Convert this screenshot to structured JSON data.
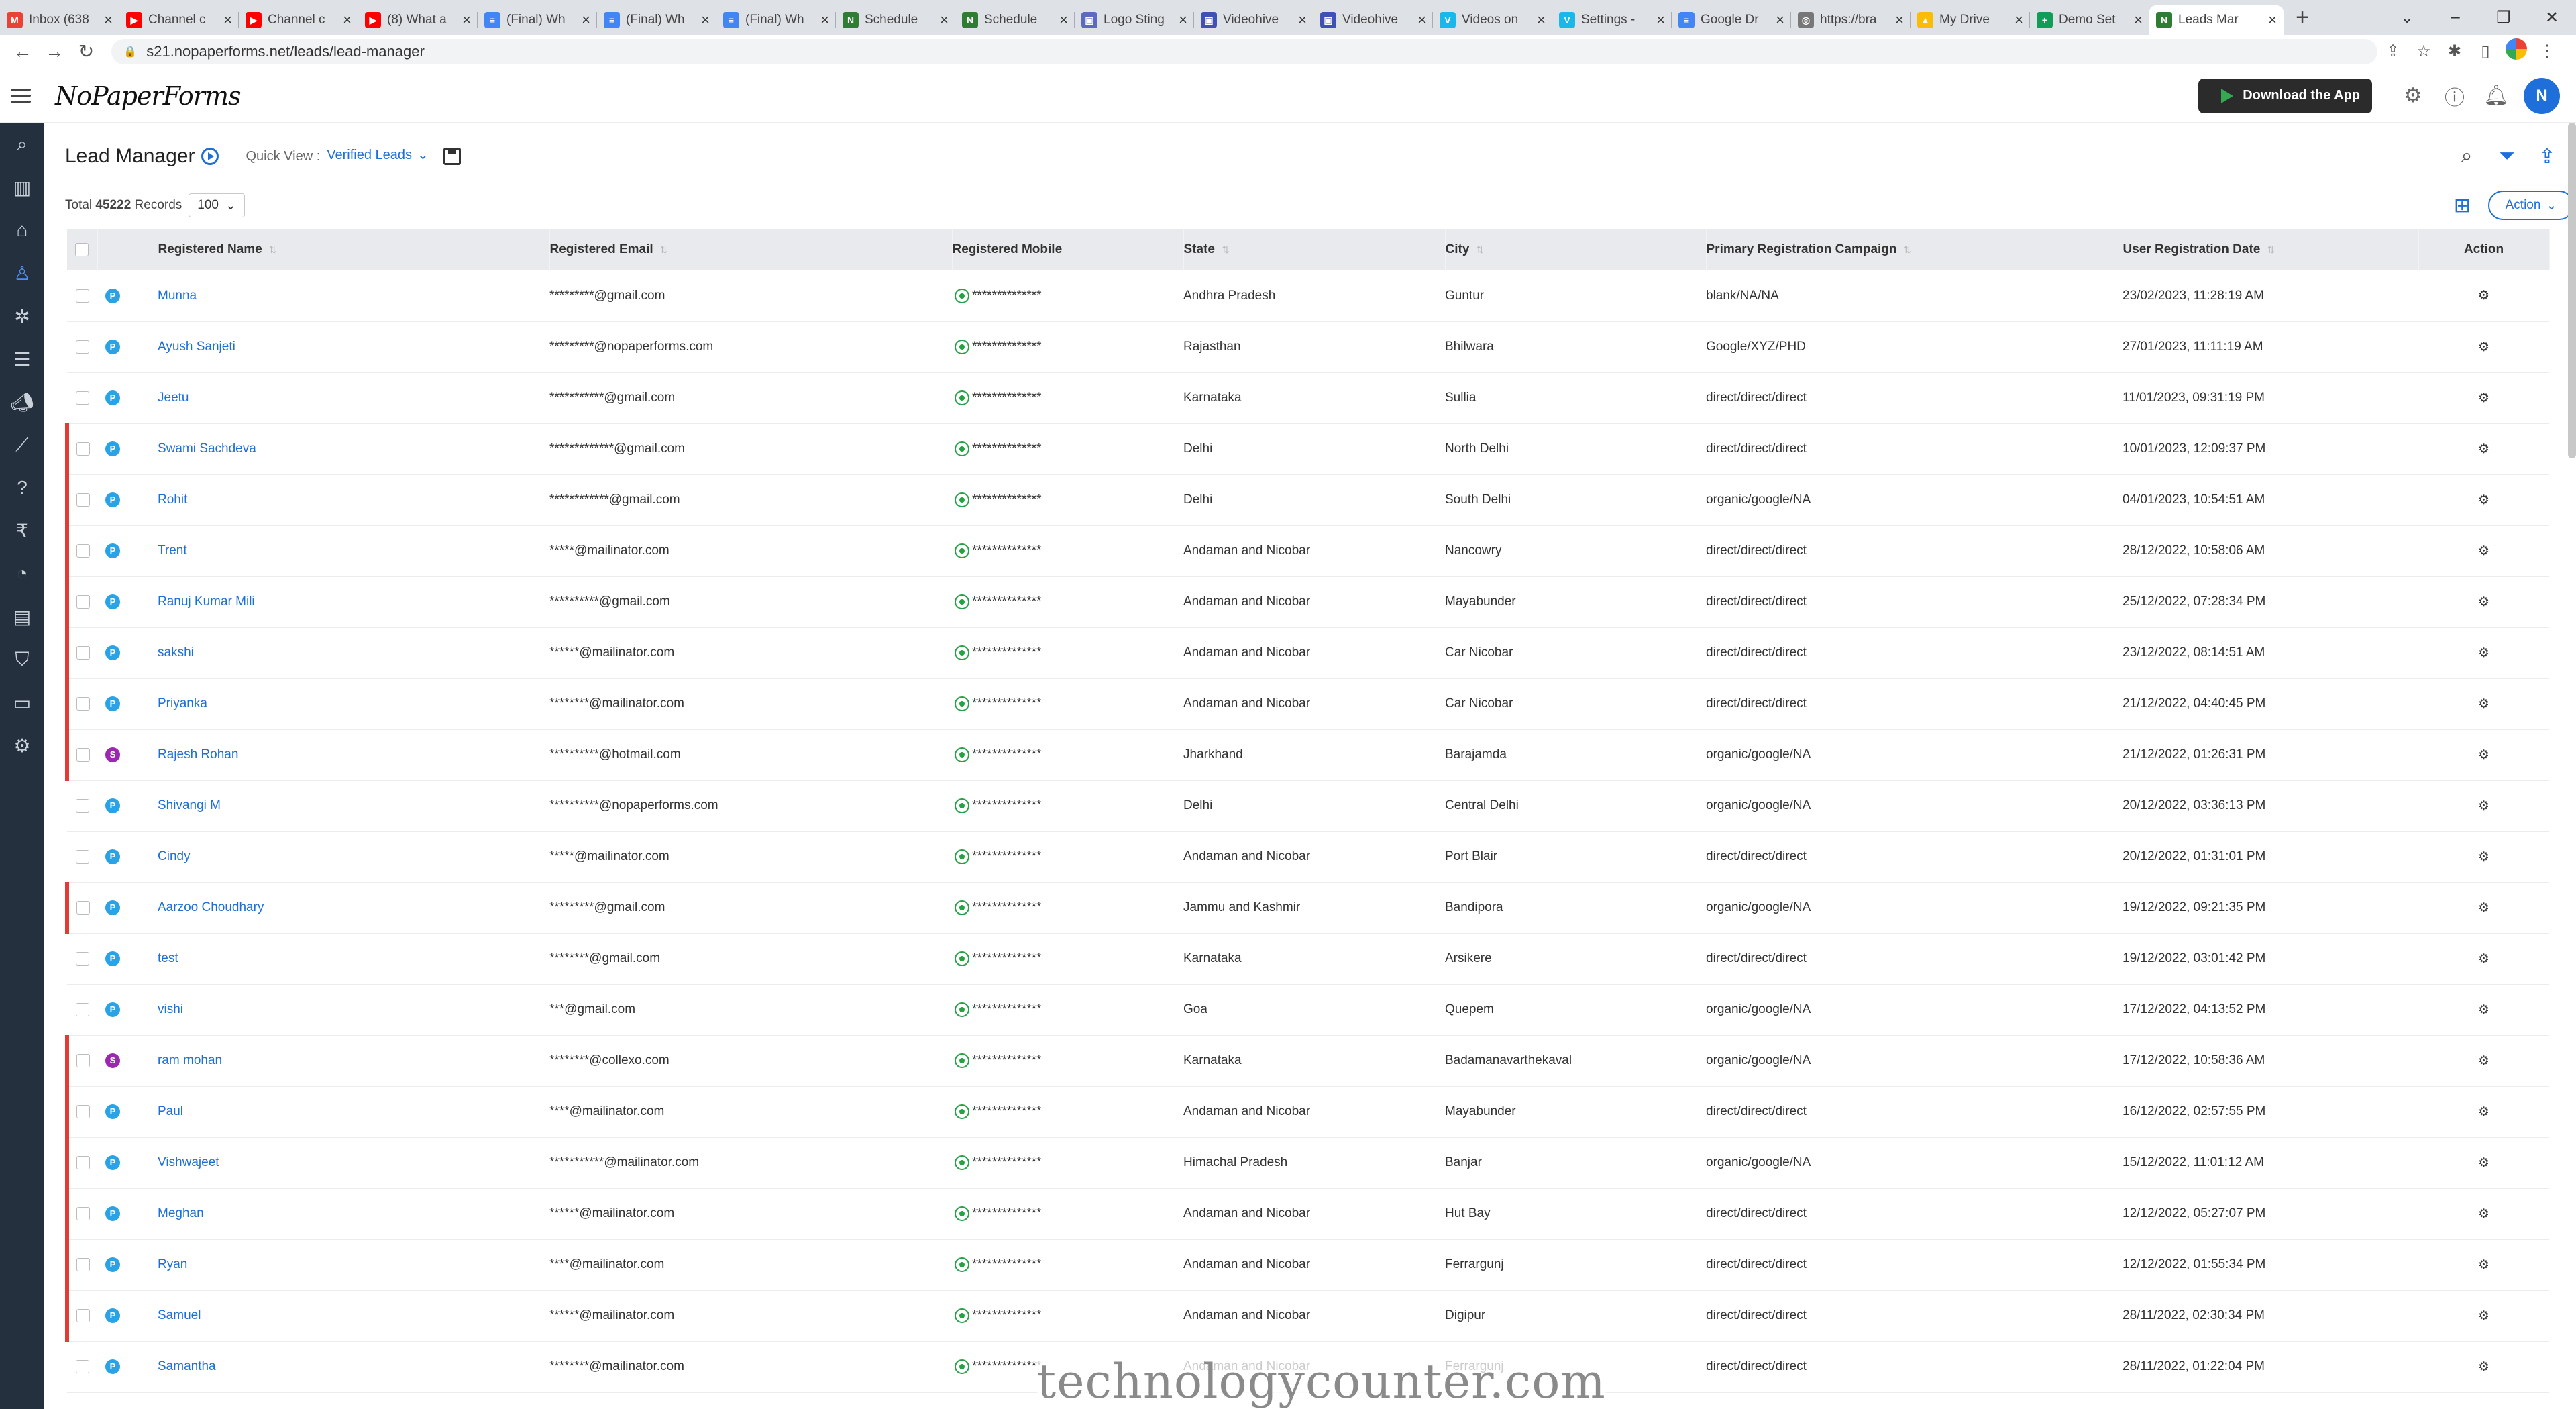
{
  "browser": {
    "tabs": [
      {
        "title": "Inbox (638",
        "icon": "M",
        "color": "#ea4335"
      },
      {
        "title": "Channel c",
        "icon": "▶",
        "color": "#ff0000"
      },
      {
        "title": "Channel c",
        "icon": "▶",
        "color": "#ff0000"
      },
      {
        "title": "(8) What a",
        "icon": "▶",
        "color": "#ff0000"
      },
      {
        "title": "(Final) Wh",
        "icon": "≡",
        "color": "#4285f4"
      },
      {
        "title": "(Final) Wh",
        "icon": "≡",
        "color": "#4285f4"
      },
      {
        "title": "(Final) Wh",
        "icon": "≡",
        "color": "#4285f4"
      },
      {
        "title": "Schedule",
        "icon": "N",
        "color": "#2e7d32"
      },
      {
        "title": "Schedule",
        "icon": "N",
        "color": "#2e7d32"
      },
      {
        "title": "Logo Sting",
        "icon": "▣",
        "color": "#5c6bc0"
      },
      {
        "title": "Videohive",
        "icon": "▣",
        "color": "#3f51b5"
      },
      {
        "title": "Videohive",
        "icon": "▣",
        "color": "#3f51b5"
      },
      {
        "title": "Videos on",
        "icon": "V",
        "color": "#1ab7ea"
      },
      {
        "title": "Settings -",
        "icon": "V",
        "color": "#1ab7ea"
      },
      {
        "title": "Google Dr",
        "icon": "≡",
        "color": "#4285f4"
      },
      {
        "title": "https://bra",
        "icon": "◎",
        "color": "#777777"
      },
      {
        "title": "My Drive",
        "icon": "▲",
        "color": "#fbbc05"
      },
      {
        "title": "Demo Set",
        "icon": "+",
        "color": "#0f9d58"
      },
      {
        "title": "Leads Mar",
        "icon": "N",
        "color": "#2e7d32",
        "active": true
      }
    ],
    "url": "s21.nopaperforms.net/leads/lead-manager"
  },
  "header": {
    "logo": "NoPaperForms",
    "download_label": "Download the App",
    "avatar_initial": "N"
  },
  "page": {
    "title": "Lead Manager",
    "quick_view_label": "Quick View :",
    "quick_view_value": "Verified Leads",
    "total_label": "Total",
    "total_count": "45222",
    "records_label": "Records",
    "page_size": "100",
    "action_label": "Action"
  },
  "table": {
    "columns": [
      "Registered Name",
      "Registered Email",
      "Registered Mobile",
      "State",
      "City",
      "Primary Registration Campaign",
      "User Registration Date",
      "Action"
    ],
    "rows": [
      {
        "flag": false,
        "src": "P",
        "name": "Munna",
        "email": "*********@gmail.com",
        "mobile": "**************",
        "state": "Andhra Pradesh",
        "city": "Guntur",
        "campaign": "blank/NA/NA",
        "date": "23/02/2023, 11:28:19 AM"
      },
      {
        "flag": false,
        "src": "P",
        "name": "Ayush Sanjeti",
        "email": "*********@nopaperforms.com",
        "mobile": "**************",
        "state": "Rajasthan",
        "city": "Bhilwara",
        "campaign": "Google/XYZ/PHD",
        "date": "27/01/2023, 11:11:19 AM"
      },
      {
        "flag": false,
        "src": "P",
        "name": "Jeetu",
        "email": "***********@gmail.com",
        "mobile": "**************",
        "state": "Karnataka",
        "city": "Sullia",
        "campaign": "direct/direct/direct",
        "date": "11/01/2023, 09:31:19 PM"
      },
      {
        "flag": true,
        "src": "P",
        "name": "Swami Sachdeva",
        "email": "*************@gmail.com",
        "mobile": "**************",
        "state": "Delhi",
        "city": "North Delhi",
        "campaign": "direct/direct/direct",
        "date": "10/01/2023, 12:09:37 PM"
      },
      {
        "flag": true,
        "src": "P",
        "name": "Rohit",
        "email": "************@gmail.com",
        "mobile": "**************",
        "state": "Delhi",
        "city": "South Delhi",
        "campaign": "organic/google/NA",
        "date": "04/01/2023, 10:54:51 AM"
      },
      {
        "flag": true,
        "src": "P",
        "name": "Trent",
        "email": "*****@mailinator.com",
        "mobile": "**************",
        "state": "Andaman and Nicobar",
        "city": "Nancowry",
        "campaign": "direct/direct/direct",
        "date": "28/12/2022, 10:58:06 AM"
      },
      {
        "flag": true,
        "src": "P",
        "name": "Ranuj Kumar Mili",
        "email": "**********@gmail.com",
        "mobile": "**************",
        "state": "Andaman and Nicobar",
        "city": "Mayabunder",
        "campaign": "direct/direct/direct",
        "date": "25/12/2022, 07:28:34 PM"
      },
      {
        "flag": true,
        "src": "P",
        "name": "sakshi",
        "email": "******@mailinator.com",
        "mobile": "**************",
        "state": "Andaman and Nicobar",
        "city": "Car Nicobar",
        "campaign": "direct/direct/direct",
        "date": "23/12/2022, 08:14:51 AM"
      },
      {
        "flag": true,
        "src": "P",
        "name": "Priyanka",
        "email": "********@mailinator.com",
        "mobile": "**************",
        "state": "Andaman and Nicobar",
        "city": "Car Nicobar",
        "campaign": "direct/direct/direct",
        "date": "21/12/2022, 04:40:45 PM"
      },
      {
        "flag": true,
        "src": "S",
        "name": "Rajesh Rohan",
        "email": "**********@hotmail.com",
        "mobile": "**************",
        "state": "Jharkhand",
        "city": "Barajamda",
        "campaign": "organic/google/NA",
        "date": "21/12/2022, 01:26:31 PM"
      },
      {
        "flag": false,
        "src": "P",
        "name": "Shivangi M",
        "email": "**********@nopaperforms.com",
        "mobile": "**************",
        "state": "Delhi",
        "city": "Central Delhi",
        "campaign": "organic/google/NA",
        "date": "20/12/2022, 03:36:13 PM"
      },
      {
        "flag": false,
        "src": "P",
        "name": "Cindy",
        "email": "*****@mailinator.com",
        "mobile": "**************",
        "state": "Andaman and Nicobar",
        "city": "Port Blair",
        "campaign": "direct/direct/direct",
        "date": "20/12/2022, 01:31:01 PM"
      },
      {
        "flag": true,
        "src": "P",
        "name": "Aarzoo Choudhary",
        "email": "*********@gmail.com",
        "mobile": "**************",
        "state": "Jammu and Kashmir",
        "city": "Bandipora",
        "campaign": "organic/google/NA",
        "date": "19/12/2022, 09:21:35 PM"
      },
      {
        "flag": false,
        "src": "P",
        "name": "test",
        "email": "********@gmail.com",
        "mobile": "**************",
        "state": "Karnataka",
        "city": "Arsikere",
        "campaign": "direct/direct/direct",
        "date": "19/12/2022, 03:01:42 PM"
      },
      {
        "flag": false,
        "src": "P",
        "name": "vishi",
        "email": "***@gmail.com",
        "mobile": "**************",
        "state": "Goa",
        "city": "Quepem",
        "campaign": "organic/google/NA",
        "date": "17/12/2022, 04:13:52 PM"
      },
      {
        "flag": true,
        "src": "S",
        "name": "ram mohan",
        "email": "********@collexo.com",
        "mobile": "**************",
        "state": "Karnataka",
        "city": "Badamanavarthekaval",
        "campaign": "organic/google/NA",
        "date": "17/12/2022, 10:58:36 AM"
      },
      {
        "flag": true,
        "src": "P",
        "name": "Paul",
        "email": "****@mailinator.com",
        "mobile": "**************",
        "state": "Andaman and Nicobar",
        "city": "Mayabunder",
        "campaign": "direct/direct/direct",
        "date": "16/12/2022, 02:57:55 PM"
      },
      {
        "flag": true,
        "src": "P",
        "name": "Vishwajeet",
        "email": "***********@mailinator.com",
        "mobile": "**************",
        "state": "Himachal Pradesh",
        "city": "Banjar",
        "campaign": "organic/google/NA",
        "date": "15/12/2022, 11:01:12 AM"
      },
      {
        "flag": true,
        "src": "P",
        "name": "Meghan",
        "email": "******@mailinator.com",
        "mobile": "**************",
        "state": "Andaman and Nicobar",
        "city": "Hut Bay",
        "campaign": "direct/direct/direct",
        "date": "12/12/2022, 05:27:07 PM"
      },
      {
        "flag": true,
        "src": "P",
        "name": "Ryan",
        "email": "****@mailinator.com",
        "mobile": "**************",
        "state": "Andaman and Nicobar",
        "city": "Ferrargunj",
        "campaign": "direct/direct/direct",
        "date": "12/12/2022, 01:55:34 PM"
      },
      {
        "flag": true,
        "src": "P",
        "name": "Samuel",
        "email": "******@mailinator.com",
        "mobile": "**************",
        "state": "Andaman and Nicobar",
        "city": "Digipur",
        "campaign": "direct/direct/direct",
        "date": "28/11/2022, 02:30:34 PM"
      },
      {
        "flag": false,
        "src": "P",
        "name": "Samantha",
        "email": "********@mailinator.com",
        "mobile": "**************",
        "state": "Andaman and Nicobar",
        "city": "Ferrargunj",
        "campaign": "direct/direct/direct",
        "date": "28/11/2022, 01:22:04 PM"
      }
    ]
  },
  "watermark": "technologycounter.com"
}
